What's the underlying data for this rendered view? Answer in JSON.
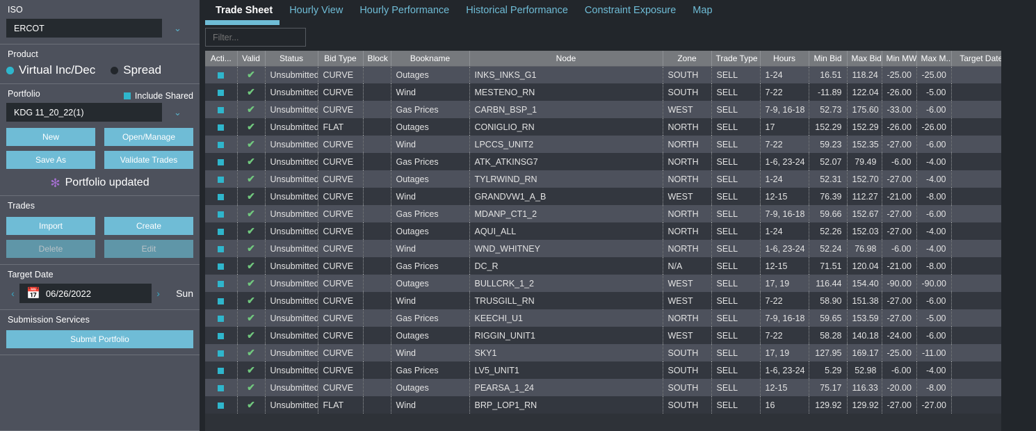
{
  "sidebar": {
    "iso": {
      "label": "ISO",
      "value": "ERCOT",
      "arrow": "⌄"
    },
    "product": {
      "label": "Product",
      "options": [
        {
          "label": "Virtual Inc/Dec",
          "selected": true
        },
        {
          "label": "Spread",
          "selected": false
        }
      ]
    },
    "portfolio": {
      "label": "Portfolio",
      "include_shared_label": "Include Shared",
      "value": "KDG 11_20_22(1)",
      "arrow": "⌄",
      "buttons": [
        {
          "label": "New",
          "disabled": false
        },
        {
          "label": "Open/Manage",
          "disabled": false
        },
        {
          "label": "Save As",
          "disabled": false
        },
        {
          "label": "Validate Trades",
          "disabled": false
        }
      ],
      "status_icon": "✻",
      "status_text": "Portfolio updated"
    },
    "trades": {
      "label": "Trades",
      "buttons": [
        {
          "label": "Import",
          "disabled": false
        },
        {
          "label": "Create",
          "disabled": false
        },
        {
          "label": "Delete",
          "disabled": true
        },
        {
          "label": "Edit",
          "disabled": true
        }
      ]
    },
    "target_date": {
      "label": "Target Date",
      "prev": "‹",
      "next": "›",
      "calendar_icon": "📅",
      "value": "06/26/2022",
      "day_of_week": "Sun"
    },
    "submission": {
      "label": "Submission Services",
      "submit_label": "Submit Portfolio"
    }
  },
  "tabs": [
    {
      "label": "Trade Sheet",
      "active": true
    },
    {
      "label": "Hourly View",
      "active": false
    },
    {
      "label": "Hourly Performance",
      "active": false
    },
    {
      "label": "Historical Performance",
      "active": false
    },
    {
      "label": "Constraint Exposure",
      "active": false
    },
    {
      "label": "Map",
      "active": false
    }
  ],
  "filter": {
    "placeholder": "Filter...",
    "value": ""
  },
  "table": {
    "columns": [
      "Acti...",
      "Valid",
      "Status",
      "Bid Type",
      "Block",
      "Bookname",
      "Node",
      "Zone",
      "Trade Type",
      "Hours",
      "Min Bid",
      "Max Bid",
      "Min MW",
      "Max M...",
      "Target Date P&L"
    ],
    "rows": [
      {
        "action": "■",
        "valid": "✔",
        "status": "Unsubmitted",
        "bid_type": "CURVE",
        "block": "",
        "bookname": "Outages",
        "node": "INKS_INKS_G1",
        "zone": "SOUTH",
        "trade_type": "SELL",
        "hours": "1-24",
        "min_bid": "16.51",
        "max_bid": "118.24",
        "min_mw": "-25.00",
        "max_mw": "-25.00",
        "pnl": ""
      },
      {
        "action": "■",
        "valid": "✔",
        "status": "Unsubmitted",
        "bid_type": "CURVE",
        "block": "",
        "bookname": "Wind",
        "node": "MESTENO_RN",
        "zone": "SOUTH",
        "trade_type": "SELL",
        "hours": "7-22",
        "min_bid": "-11.89",
        "max_bid": "122.04",
        "min_mw": "-26.00",
        "max_mw": "-5.00",
        "pnl": ""
      },
      {
        "action": "■",
        "valid": "✔",
        "status": "Unsubmitted",
        "bid_type": "CURVE",
        "block": "",
        "bookname": "Gas Prices",
        "node": "CARBN_BSP_1",
        "zone": "WEST",
        "trade_type": "SELL",
        "hours": "7-9, 16-18",
        "min_bid": "52.73",
        "max_bid": "175.60",
        "min_mw": "-33.00",
        "max_mw": "-6.00",
        "pnl": ""
      },
      {
        "action": "■",
        "valid": "✔",
        "status": "Unsubmitted",
        "bid_type": "FLAT",
        "block": "",
        "bookname": "Outages",
        "node": "CONIGLIO_RN",
        "zone": "NORTH",
        "trade_type": "SELL",
        "hours": "17",
        "min_bid": "152.29",
        "max_bid": "152.29",
        "min_mw": "-26.00",
        "max_mw": "-26.00",
        "pnl": ""
      },
      {
        "action": "■",
        "valid": "✔",
        "status": "Unsubmitted",
        "bid_type": "CURVE",
        "block": "",
        "bookname": "Wind",
        "node": "LPCCS_UNIT2",
        "zone": "NORTH",
        "trade_type": "SELL",
        "hours": "7-22",
        "min_bid": "59.23",
        "max_bid": "152.35",
        "min_mw": "-27.00",
        "max_mw": "-6.00",
        "pnl": ""
      },
      {
        "action": "■",
        "valid": "✔",
        "status": "Unsubmitted",
        "bid_type": "CURVE",
        "block": "",
        "bookname": "Gas Prices",
        "node": "ATK_ATKINSG7",
        "zone": "NORTH",
        "trade_type": "SELL",
        "hours": "1-6, 23-24",
        "min_bid": "52.07",
        "max_bid": "79.49",
        "min_mw": "-6.00",
        "max_mw": "-4.00",
        "pnl": ""
      },
      {
        "action": "■",
        "valid": "✔",
        "status": "Unsubmitted",
        "bid_type": "CURVE",
        "block": "",
        "bookname": "Outages",
        "node": "TYLRWIND_RN",
        "zone": "NORTH",
        "trade_type": "SELL",
        "hours": "1-24",
        "min_bid": "52.31",
        "max_bid": "152.70",
        "min_mw": "-27.00",
        "max_mw": "-4.00",
        "pnl": ""
      },
      {
        "action": "■",
        "valid": "✔",
        "status": "Unsubmitted",
        "bid_type": "CURVE",
        "block": "",
        "bookname": "Wind",
        "node": "GRANDVW1_A_B",
        "zone": "WEST",
        "trade_type": "SELL",
        "hours": "12-15",
        "min_bid": "76.39",
        "max_bid": "112.27",
        "min_mw": "-21.00",
        "max_mw": "-8.00",
        "pnl": ""
      },
      {
        "action": "■",
        "valid": "✔",
        "status": "Unsubmitted",
        "bid_type": "CURVE",
        "block": "",
        "bookname": "Gas Prices",
        "node": "MDANP_CT1_2",
        "zone": "NORTH",
        "trade_type": "SELL",
        "hours": "7-9, 16-18",
        "min_bid": "59.66",
        "max_bid": "152.67",
        "min_mw": "-27.00",
        "max_mw": "-6.00",
        "pnl": ""
      },
      {
        "action": "■",
        "valid": "✔",
        "status": "Unsubmitted",
        "bid_type": "CURVE",
        "block": "",
        "bookname": "Outages",
        "node": "AQUI_ALL",
        "zone": "NORTH",
        "trade_type": "SELL",
        "hours": "1-24",
        "min_bid": "52.26",
        "max_bid": "152.03",
        "min_mw": "-27.00",
        "max_mw": "-4.00",
        "pnl": ""
      },
      {
        "action": "■",
        "valid": "✔",
        "status": "Unsubmitted",
        "bid_type": "CURVE",
        "block": "",
        "bookname": "Wind",
        "node": "WND_WHITNEY",
        "zone": "NORTH",
        "trade_type": "SELL",
        "hours": "1-6, 23-24",
        "min_bid": "52.24",
        "max_bid": "76.98",
        "min_mw": "-6.00",
        "max_mw": "-4.00",
        "pnl": ""
      },
      {
        "action": "■",
        "valid": "✔",
        "status": "Unsubmitted",
        "bid_type": "CURVE",
        "block": "",
        "bookname": "Gas Prices",
        "node": "DC_R",
        "zone": "N/A",
        "trade_type": "SELL",
        "hours": "12-15",
        "min_bid": "71.51",
        "max_bid": "120.04",
        "min_mw": "-21.00",
        "max_mw": "-8.00",
        "pnl": ""
      },
      {
        "action": "■",
        "valid": "✔",
        "status": "Unsubmitted",
        "bid_type": "CURVE",
        "block": "",
        "bookname": "Outages",
        "node": "BULLCRK_1_2",
        "zone": "WEST",
        "trade_type": "SELL",
        "hours": "17, 19",
        "min_bid": "116.44",
        "max_bid": "154.40",
        "min_mw": "-90.00",
        "max_mw": "-90.00",
        "pnl": ""
      },
      {
        "action": "■",
        "valid": "✔",
        "status": "Unsubmitted",
        "bid_type": "CURVE",
        "block": "",
        "bookname": "Wind",
        "node": "TRUSGILL_RN",
        "zone": "WEST",
        "trade_type": "SELL",
        "hours": "7-22",
        "min_bid": "58.90",
        "max_bid": "151.38",
        "min_mw": "-27.00",
        "max_mw": "-6.00",
        "pnl": ""
      },
      {
        "action": "■",
        "valid": "✔",
        "status": "Unsubmitted",
        "bid_type": "CURVE",
        "block": "",
        "bookname": "Gas Prices",
        "node": "KEECHI_U1",
        "zone": "NORTH",
        "trade_type": "SELL",
        "hours": "7-9, 16-18",
        "min_bid": "59.65",
        "max_bid": "153.59",
        "min_mw": "-27.00",
        "max_mw": "-5.00",
        "pnl": ""
      },
      {
        "action": "■",
        "valid": "✔",
        "status": "Unsubmitted",
        "bid_type": "CURVE",
        "block": "",
        "bookname": "Outages",
        "node": "RIGGIN_UNIT1",
        "zone": "WEST",
        "trade_type": "SELL",
        "hours": "7-22",
        "min_bid": "58.28",
        "max_bid": "140.18",
        "min_mw": "-24.00",
        "max_mw": "-6.00",
        "pnl": ""
      },
      {
        "action": "■",
        "valid": "✔",
        "status": "Unsubmitted",
        "bid_type": "CURVE",
        "block": "",
        "bookname": "Wind",
        "node": "SKY1",
        "zone": "SOUTH",
        "trade_type": "SELL",
        "hours": "17, 19",
        "min_bid": "127.95",
        "max_bid": "169.17",
        "min_mw": "-25.00",
        "max_mw": "-11.00",
        "pnl": ""
      },
      {
        "action": "■",
        "valid": "✔",
        "status": "Unsubmitted",
        "bid_type": "CURVE",
        "block": "",
        "bookname": "Gas Prices",
        "node": "LV5_UNIT1",
        "zone": "SOUTH",
        "trade_type": "SELL",
        "hours": "1-6, 23-24",
        "min_bid": "5.29",
        "max_bid": "52.98",
        "min_mw": "-6.00",
        "max_mw": "-4.00",
        "pnl": ""
      },
      {
        "action": "■",
        "valid": "✔",
        "status": "Unsubmitted",
        "bid_type": "CURVE",
        "block": "",
        "bookname": "Outages",
        "node": "PEARSA_1_24",
        "zone": "SOUTH",
        "trade_type": "SELL",
        "hours": "12-15",
        "min_bid": "75.17",
        "max_bid": "116.33",
        "min_mw": "-20.00",
        "max_mw": "-8.00",
        "pnl": ""
      },
      {
        "action": "■",
        "valid": "✔",
        "status": "Unsubmitted",
        "bid_type": "FLAT",
        "block": "",
        "bookname": "Wind",
        "node": "BRP_LOP1_RN",
        "zone": "SOUTH",
        "trade_type": "SELL",
        "hours": "16",
        "min_bid": "129.92",
        "max_bid": "129.92",
        "min_mw": "-27.00",
        "max_mw": "-27.00",
        "pnl": ""
      }
    ]
  },
  "colors": {
    "accent": "#6fbcd6",
    "teal": "#2fb6cc",
    "negative": "#e8645f",
    "valid_green": "#71c87e",
    "sidebar_bg": "#4d515c",
    "app_bg": "#22262b",
    "star_purple": "#a46fd0"
  }
}
